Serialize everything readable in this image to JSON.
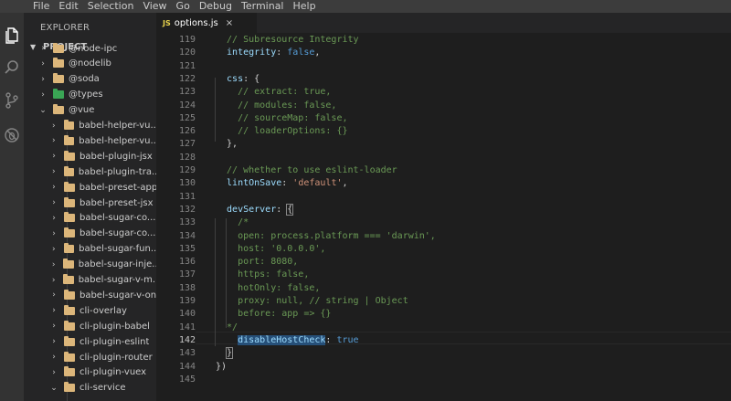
{
  "menu": [
    "File",
    "Edit",
    "Selection",
    "View",
    "Go",
    "Debug",
    "Terminal",
    "Help"
  ],
  "sidebar": {
    "title": "EXPLORER",
    "project": "PROJECT",
    "items": [
      {
        "label": "@node-ipc",
        "depth": 1,
        "open": false
      },
      {
        "label": "@nodelib",
        "depth": 1,
        "open": false
      },
      {
        "label": "@soda",
        "depth": 1,
        "open": false
      },
      {
        "label": "@types",
        "depth": 1,
        "open": false,
        "special": true
      },
      {
        "label": "@vue",
        "depth": 1,
        "open": true
      },
      {
        "label": "babel-helper-vu...",
        "depth": 2,
        "open": false
      },
      {
        "label": "babel-helper-vu...",
        "depth": 2,
        "open": false
      },
      {
        "label": "babel-plugin-jsx",
        "depth": 2,
        "open": false
      },
      {
        "label": "babel-plugin-tra...",
        "depth": 2,
        "open": false
      },
      {
        "label": "babel-preset-app",
        "depth": 2,
        "open": false
      },
      {
        "label": "babel-preset-jsx",
        "depth": 2,
        "open": false
      },
      {
        "label": "babel-sugar-co...",
        "depth": 2,
        "open": false
      },
      {
        "label": "babel-sugar-co...",
        "depth": 2,
        "open": false
      },
      {
        "label": "babel-sugar-fun...",
        "depth": 2,
        "open": false
      },
      {
        "label": "babel-sugar-inje...",
        "depth": 2,
        "open": false
      },
      {
        "label": "babel-sugar-v-m...",
        "depth": 2,
        "open": false
      },
      {
        "label": "babel-sugar-v-on",
        "depth": 2,
        "open": false
      },
      {
        "label": "cli-overlay",
        "depth": 2,
        "open": false
      },
      {
        "label": "cli-plugin-babel",
        "depth": 2,
        "open": false
      },
      {
        "label": "cli-plugin-eslint",
        "depth": 2,
        "open": false
      },
      {
        "label": "cli-plugin-router",
        "depth": 2,
        "open": false
      },
      {
        "label": "cli-plugin-vuex",
        "depth": 2,
        "open": false
      },
      {
        "label": "cli-service",
        "depth": 2,
        "open": true
      }
    ]
  },
  "tab": {
    "icon": "JS",
    "label": "options.js",
    "close": "×"
  },
  "editor": {
    "lines": [
      {
        "n": "119",
        "tokens": [
          [
            "c",
            "  // Subresource Integrity"
          ]
        ]
      },
      {
        "n": "120",
        "tokens": [
          [
            "k",
            "  integrity"
          ],
          [
            "p",
            ": "
          ],
          [
            "v",
            "false"
          ],
          [
            "p",
            ","
          ]
        ]
      },
      {
        "n": "121",
        "tokens": []
      },
      {
        "n": "122",
        "tokens": [
          [
            "k",
            "  css"
          ],
          [
            "p",
            ": {"
          ]
        ]
      },
      {
        "n": "123",
        "tokens": [
          [
            "c",
            "    // extract: true,"
          ]
        ]
      },
      {
        "n": "124",
        "tokens": [
          [
            "c",
            "    // modules: false,"
          ]
        ]
      },
      {
        "n": "125",
        "tokens": [
          [
            "c",
            "    // sourceMap: false,"
          ]
        ]
      },
      {
        "n": "126",
        "tokens": [
          [
            "c",
            "    // loaderOptions: {}"
          ]
        ]
      },
      {
        "n": "127",
        "tokens": [
          [
            "p",
            "  },"
          ]
        ]
      },
      {
        "n": "128",
        "tokens": []
      },
      {
        "n": "129",
        "tokens": [
          [
            "c",
            "  // whether to use eslint-loader"
          ]
        ]
      },
      {
        "n": "130",
        "tokens": [
          [
            "k",
            "  lintOnSave"
          ],
          [
            "p",
            ": "
          ],
          [
            "s",
            "'default'"
          ],
          [
            "p",
            ","
          ]
        ]
      },
      {
        "n": "131",
        "tokens": []
      },
      {
        "n": "132",
        "tokens": [
          [
            "k",
            "  devServer"
          ],
          [
            "p",
            ": "
          ],
          [
            "box",
            "{"
          ]
        ]
      },
      {
        "n": "133",
        "tokens": [
          [
            "c",
            "    /*"
          ]
        ]
      },
      {
        "n": "134",
        "tokens": [
          [
            "c",
            "    open: process.platform === 'darwin',"
          ]
        ]
      },
      {
        "n": "135",
        "tokens": [
          [
            "c",
            "    host: '0.0.0.0',"
          ]
        ]
      },
      {
        "n": "136",
        "tokens": [
          [
            "c",
            "    port: 8080,"
          ]
        ]
      },
      {
        "n": "137",
        "tokens": [
          [
            "c",
            "    https: false,"
          ]
        ]
      },
      {
        "n": "138",
        "tokens": [
          [
            "c",
            "    hotOnly: false,"
          ]
        ]
      },
      {
        "n": "139",
        "tokens": [
          [
            "c",
            "    proxy: null, // string | Object"
          ]
        ]
      },
      {
        "n": "140",
        "tokens": [
          [
            "c",
            "    before: app => {}"
          ]
        ]
      },
      {
        "n": "141",
        "tokens": [
          [
            "c",
            "  */"
          ]
        ]
      },
      {
        "n": "142",
        "tokens": [
          [
            "p",
            "    "
          ],
          [
            "sel",
            "disableHostCheck"
          ],
          [
            "p",
            ": "
          ],
          [
            "v",
            "true"
          ]
        ],
        "active": true
      },
      {
        "n": "143",
        "tokens": [
          [
            "p",
            "  "
          ],
          [
            "box",
            "}"
          ]
        ]
      },
      {
        "n": "144",
        "tokens": [
          [
            "p",
            "})"
          ]
        ]
      },
      {
        "n": "145",
        "tokens": []
      }
    ]
  },
  "colors": {
    "menubar": "#3c3c3c",
    "activitybar": "#333333",
    "sidebar": "#252526",
    "editor": "#1e1e1e",
    "comment": "#6a9955",
    "property": "#9cdcfe",
    "keyword": "#569cd6",
    "string": "#ce9178",
    "selection": "#264f78"
  }
}
